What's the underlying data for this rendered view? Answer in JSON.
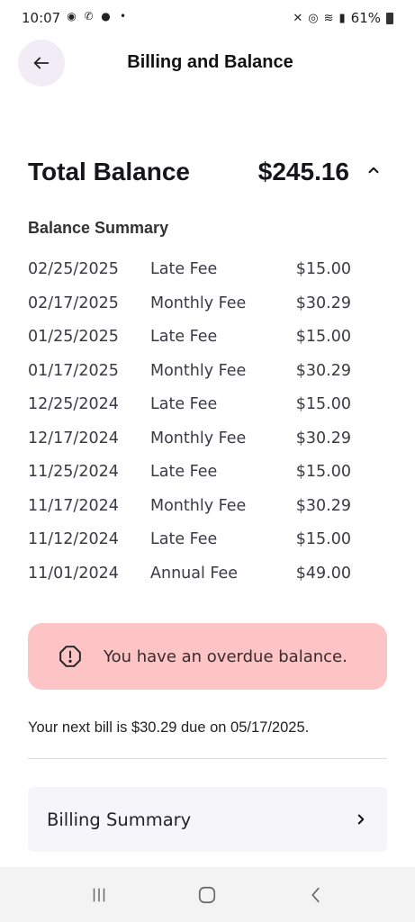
{
  "status_bar": {
    "time": "10:07",
    "battery": "61%",
    "dot": "•"
  },
  "header": {
    "title": "Billing and Balance"
  },
  "balance": {
    "label": "Total Balance",
    "amount": "$245.16"
  },
  "summary": {
    "heading": "Balance Summary",
    "rows": [
      {
        "date": "02/25/2025",
        "desc": "Late Fee",
        "amount": "$15.00"
      },
      {
        "date": "02/17/2025",
        "desc": "Monthly Fee",
        "amount": "$30.29"
      },
      {
        "date": "01/25/2025",
        "desc": "Late Fee",
        "amount": "$15.00"
      },
      {
        "date": "01/17/2025",
        "desc": "Monthly Fee",
        "amount": "$30.29"
      },
      {
        "date": "12/25/2024",
        "desc": "Late Fee",
        "amount": "$15.00"
      },
      {
        "date": "12/17/2024",
        "desc": "Monthly Fee",
        "amount": "$30.29"
      },
      {
        "date": "11/25/2024",
        "desc": "Late Fee",
        "amount": "$15.00"
      },
      {
        "date": "11/17/2024",
        "desc": "Monthly Fee",
        "amount": "$30.29"
      },
      {
        "date": "11/12/2024",
        "desc": "Late Fee",
        "amount": "$15.00"
      },
      {
        "date": "11/01/2024",
        "desc": "Annual Fee",
        "amount": "$49.00"
      }
    ]
  },
  "alert": {
    "text": "You have an overdue balance.",
    "color": "#fcc4c4"
  },
  "next_bill": {
    "text": "Your next bill is $30.29 due on 05/17/2025."
  },
  "billing_card": {
    "label": "Billing Summary"
  },
  "icons": {
    "back": "arrow-left-icon",
    "collapse": "chevron-up-icon",
    "alert": "octagon-exclamation-icon",
    "forward": "chevron-right-icon"
  }
}
